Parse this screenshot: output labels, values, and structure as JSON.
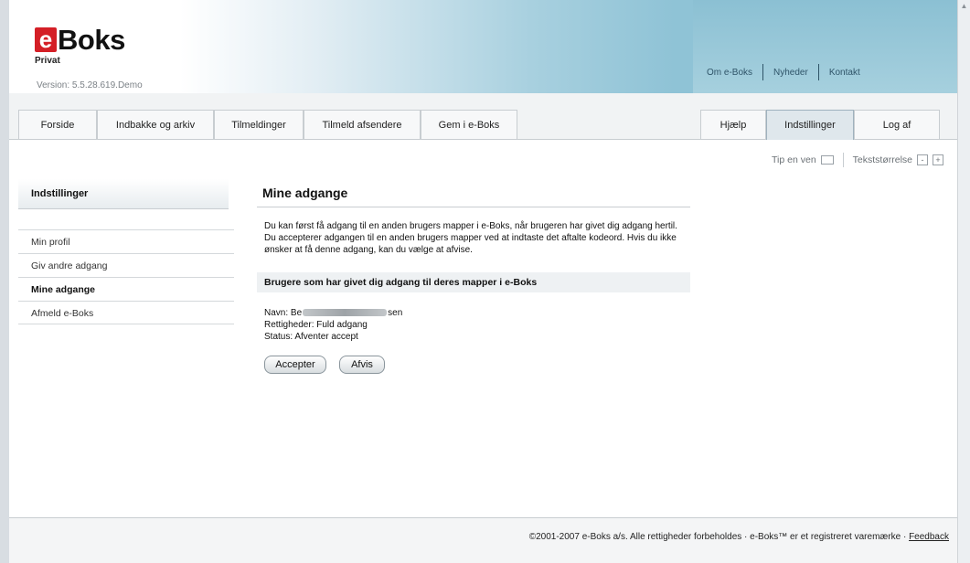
{
  "brand": {
    "logo_letter": "e",
    "logo_rest": "Boks",
    "subtitle": "Privat",
    "version": "Version: 5.5.28.619.Demo"
  },
  "toplinks": [
    "Om e-Boks",
    "Nyheder",
    "Kontakt"
  ],
  "tabs_left": [
    "Forside",
    "Indbakke og arkiv",
    "Tilmeldinger",
    "Tilmeld afsendere",
    "Gem i e-Boks"
  ],
  "tabs_right": [
    "Hjælp",
    "Indstillinger",
    "Log af"
  ],
  "active_tab": "Indstillinger",
  "utility": {
    "tip": "Tip en ven",
    "textsize": "Tekststørrelse",
    "minus": "-",
    "plus": "+"
  },
  "sidebar": {
    "heading": "Indstillinger",
    "items": [
      "Min profil",
      "Giv andre adgang",
      "Mine adgange",
      "Afmeld e-Boks"
    ],
    "active_item": "Mine adgange"
  },
  "main": {
    "title": "Mine adgange",
    "intro": "Du kan først få adgang til en anden brugers mapper i e-Boks, når brugeren har givet dig adgang hertil. Du accepterer adgangen til en anden brugers mapper ved at indtaste det aftalte kodeord. Hvis du ikke ønsker at få denne adgang, kan du vælge at afvise.",
    "section": "Brugere som har givet dig adgang til deres mapper i e-Boks",
    "name_label": "Navn: Be",
    "name_suffix": "sen",
    "rights": "Rettigheder: Fuld adgang",
    "status": "Status: Afventer accept",
    "accept": "Accepter",
    "reject": "Afvis"
  },
  "footer": {
    "text": "©2001-2007 e-Boks a/s. Alle rettigheder forbeholdes · e-Boks™ er et registreret varemærke · ",
    "link": "Feedback"
  },
  "colors": {
    "logo_red": "#d41f26",
    "header_blue": "#8ec3d6"
  }
}
